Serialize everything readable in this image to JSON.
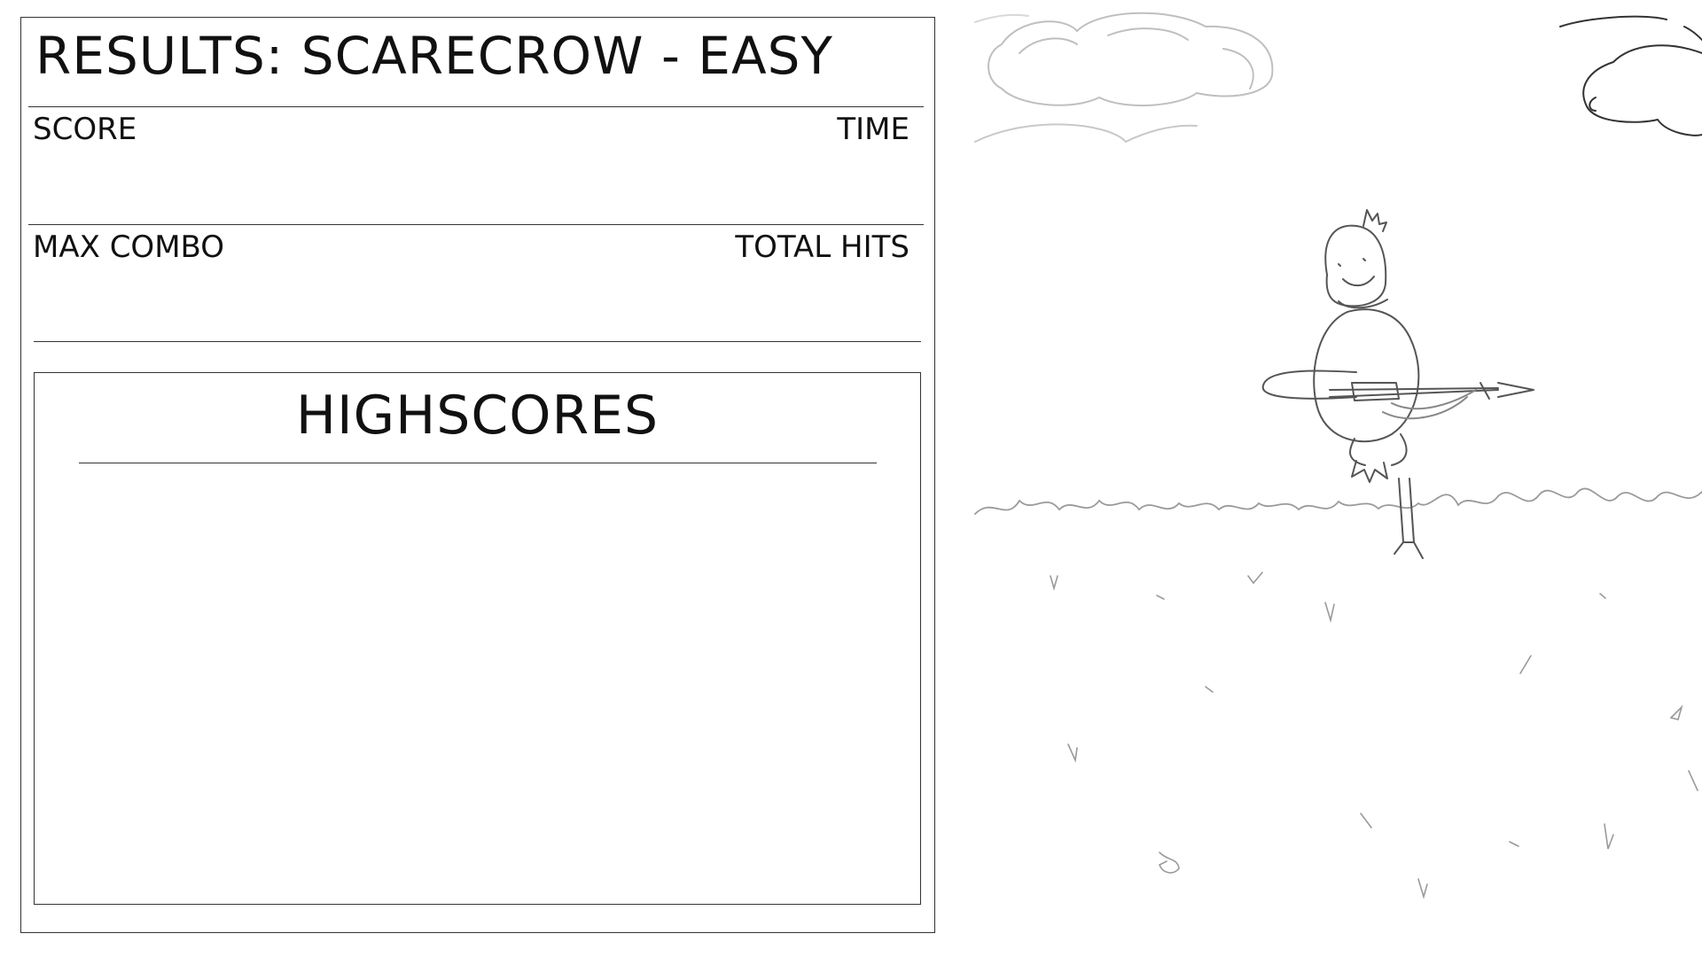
{
  "results": {
    "title": "RESULTS: SCARECROW - EASY",
    "score_label": "SCORE",
    "score_value": "",
    "time_label": "TIME",
    "time_value": "",
    "max_combo_label": "MAX COMBO",
    "max_combo_value": "",
    "total_hits_label": "TOTAL HITS",
    "total_hits_value": ""
  },
  "highscores": {
    "title": "HIGHSCORES",
    "entries": []
  },
  "scene": {
    "sky_color": "#ffffff",
    "line_color": "#555555",
    "figure": "scarecrow"
  }
}
